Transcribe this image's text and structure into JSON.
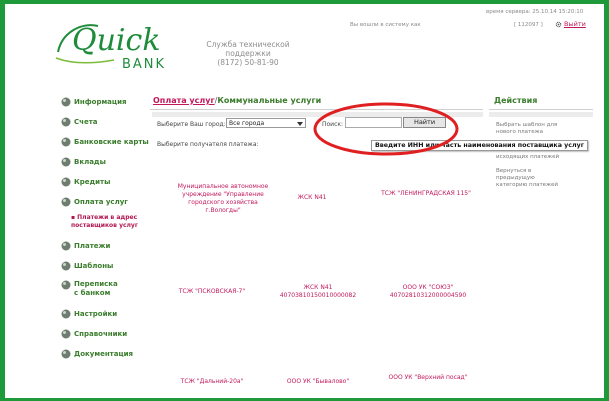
{
  "header": {
    "bank_name_line1": "Quick",
    "bank_name_line2": "BANK",
    "support_title": "Служба технической поддержки",
    "support_phone": "(8172) 50-81-90",
    "server_time": "время сервера: 25.10.14 15:20:10",
    "welcome": "Вы вошли в систему как",
    "user_id": "[ 112097 ]",
    "logout": "Выйти"
  },
  "sidebar": {
    "items": [
      {
        "label": "Информация"
      },
      {
        "label": "Счета"
      },
      {
        "label": "Банковские карты"
      },
      {
        "label": "Вклады"
      },
      {
        "label": "Кредиты"
      },
      {
        "label": "Оплата услуг"
      },
      {
        "label": "Платежи"
      },
      {
        "label": "Шаблоны"
      },
      {
        "label": "Переписка с банком"
      },
      {
        "label": "Настройки"
      },
      {
        "label": "Справочники"
      },
      {
        "label": "Документация"
      }
    ],
    "subitem": "Платежи в адрес поставщиков услуг"
  },
  "breadcrumb": {
    "link": "Оплата услуг",
    "separator": "/",
    "current": "Коммунальные услуги"
  },
  "filters": {
    "city_label": "Выберите Ваш город:",
    "city_value": "Все города",
    "search_label": "Поиск:",
    "search_value": "",
    "find_button": "Найти",
    "recipient_label": "Выберите получателя платежа:"
  },
  "tooltip": "Введите ИНН или часть наименования поставщика услуг",
  "vendors": [
    "Муниципальное автономное учреждение \"Управление городского хозяйства г.Вологды\"",
    "ЖСК N41",
    "ТСЖ \"ЛЕНИНГРАДСКАЯ 115\"",
    "ТСЖ \"ПСКОВСКАЯ-7\"",
    "ЖСК N41 40703810150010000082",
    "ООО УК \"СОЮЗ\" 40702810312000004590",
    "ТСЖ \"Дальний-20а\"",
    "ООО УК \"Бывалово\"",
    "ООО УК \"Верхний посад\""
  ],
  "actions": {
    "title": "Действия",
    "items": [
      "Выбрать шаблон для нового платежа",
      "исходящих платежей",
      "Вернуться в предыдущую категорию платежей"
    ]
  },
  "colors": {
    "frame_green": "#1f9a3a",
    "link_magenta": "#c2185b",
    "nav_green": "#3a7d2c",
    "highlight_red": "#e02020"
  }
}
